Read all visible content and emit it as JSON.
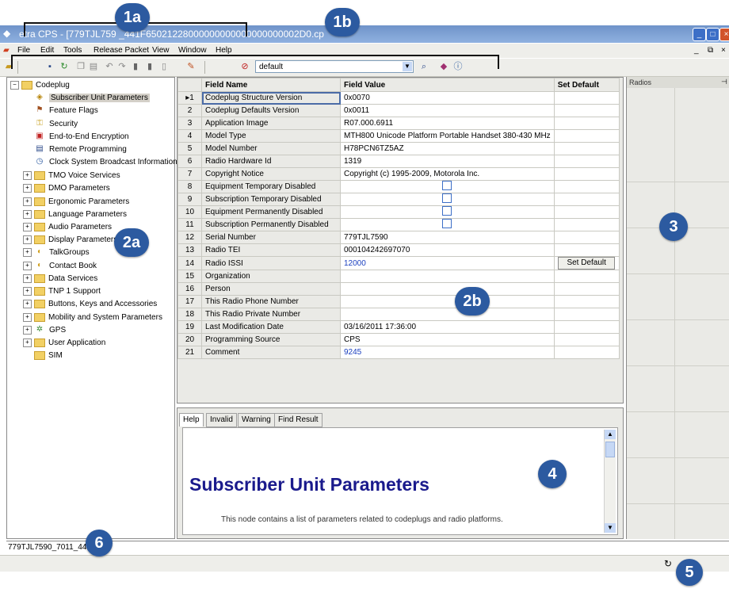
{
  "window": {
    "title": "etra CPS - [779TJL759 _441F65021228000000000000000000002D0.cp"
  },
  "menu": {
    "items": [
      {
        "label": "File"
      },
      {
        "label": "Edit"
      },
      {
        "label": "Tools"
      },
      {
        "label": "Release Packet"
      },
      {
        "label": "View"
      },
      {
        "label": "Window"
      },
      {
        "label": "Help"
      }
    ]
  },
  "toolbar": {
    "profile_value": "default"
  },
  "tree": {
    "root": "Codeplug",
    "children": [
      {
        "label": "Subscriber Unit Parameters",
        "icon": "tag-icon"
      },
      {
        "label": "Feature Flags",
        "icon": "flag-icon"
      },
      {
        "label": "Security",
        "icon": "key-icon"
      },
      {
        "label": "End-to-End Encryption",
        "icon": "lock-icon"
      },
      {
        "label": "Remote Programming",
        "icon": "remote-icon"
      },
      {
        "label": "Clock System Broadcast Information",
        "icon": "clock-icon"
      }
    ],
    "folders": [
      "TMO Voice Services",
      "DMO Parameters",
      "Ergonomic Parameters",
      "Language Parameters",
      "Audio Parameters",
      "Display Parameters",
      "TalkGroups",
      "Contact Book",
      "Data Services",
      "TNP 1 Support",
      "Buttons, Keys and Accessories",
      "Mobility and System Parameters",
      "GPS",
      "User Application",
      "SIM"
    ]
  },
  "grid": {
    "headers": [
      "Field Name",
      "Field Value",
      "Set Default"
    ],
    "rows": [
      {
        "num": "1",
        "name": "Codeplug Structure Version",
        "value": "0x0070"
      },
      {
        "num": "2",
        "name": "Codeplug Defaults Version",
        "value": "0x0011"
      },
      {
        "num": "3",
        "name": "Application Image",
        "value": "R07.000.6911"
      },
      {
        "num": "4",
        "name": "Model Type",
        "value": "MTH800 Unicode Platform Portable Handset 380-430 MHz"
      },
      {
        "num": "5",
        "name": "Model Number",
        "value": "H78PCN6TZ5AZ"
      },
      {
        "num": "6",
        "name": "Radio Hardware Id",
        "value": "1319"
      },
      {
        "num": "7",
        "name": "Copyright Notice",
        "value": "Copyright (c) 1995-2009, Motorola Inc."
      },
      {
        "num": "8",
        "name": "Equipment Temporary Disabled",
        "value": ""
      },
      {
        "num": "9",
        "name": "Subscription Temporary Disabled",
        "value": ""
      },
      {
        "num": "10",
        "name": "Equipment Permanently Disabled",
        "value": ""
      },
      {
        "num": "11",
        "name": "Subscription Permanently Disabled",
        "value": ""
      },
      {
        "num": "12",
        "name": "Serial Number",
        "value": "779TJL7590"
      },
      {
        "num": "13",
        "name": "Radio TEI",
        "value": "000104242697070"
      },
      {
        "num": "14",
        "name": "Radio ISSI",
        "value": "12000",
        "default_label": "Set Default"
      },
      {
        "num": "15",
        "name": "Organization",
        "value": ""
      },
      {
        "num": "16",
        "name": "Person",
        "value": ""
      },
      {
        "num": "17",
        "name": "This Radio Phone Number",
        "value": ""
      },
      {
        "num": "18",
        "name": "This Radio Private Number",
        "value": ""
      },
      {
        "num": "19",
        "name": "Last Modification Date",
        "value": "03/16/2011 17:36:00"
      },
      {
        "num": "20",
        "name": "Programming Source",
        "value": "CPS"
      },
      {
        "num": "21",
        "name": "Comment",
        "value": "9245"
      }
    ]
  },
  "help": {
    "tabs": [
      "Help",
      "Invalid",
      "Warning",
      "Find Result"
    ],
    "title": "Subscriber Unit Parameters",
    "text": "This node contains a list of parameters related to codeplugs and radio platforms."
  },
  "radios": {
    "header": "Radios"
  },
  "status": {
    "path": "779TJL7590_7011_441"
  },
  "callouts": [
    "1a",
    "1b",
    "2a",
    "2b",
    "3",
    "4",
    "5",
    "6"
  ]
}
